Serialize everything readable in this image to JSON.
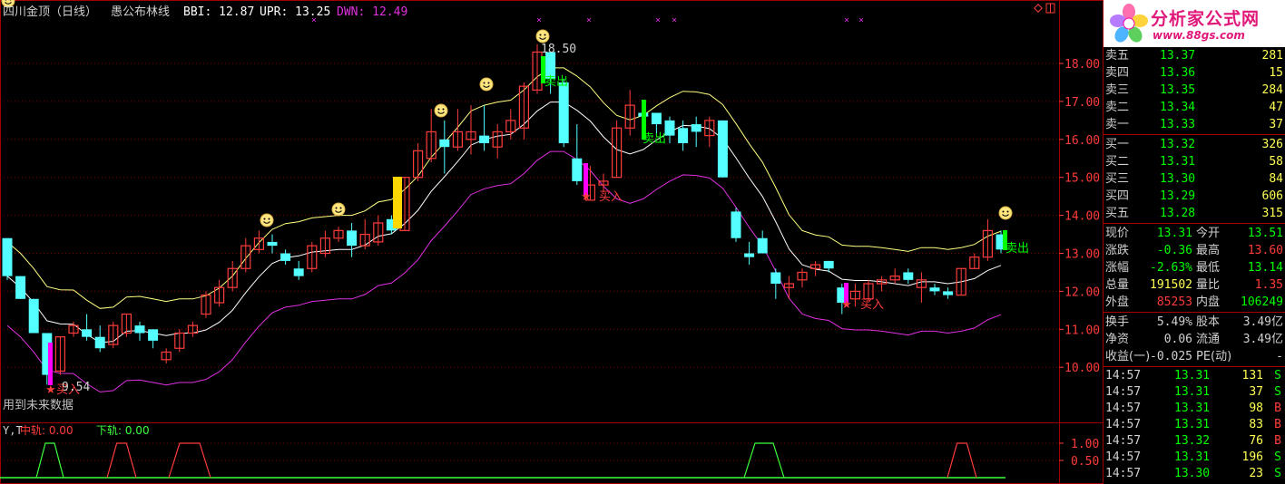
{
  "title": {
    "name": "四川金顶（日线）",
    "indicator": "愚公布林线",
    "bbi": "BBI: 12.87",
    "upr": "UPR: 13.25",
    "dwn": "DWN: 12.49"
  },
  "chart": {
    "high_price": "18.50",
    "low_price": "9.54",
    "warning": "用到未来数据",
    "signals": {
      "buy": "买入",
      "sell": "卖出"
    }
  },
  "price_axis": [
    "18.00",
    "17.00",
    "16.00",
    "15.00",
    "14.00",
    "13.00",
    "12.00",
    "11.00",
    "10.00"
  ],
  "sub_indicator": {
    "name": "Y,T",
    "mid": "中轨: 0.00",
    "low": "下轨: 0.00",
    "axis": [
      "1.00",
      "0.50"
    ]
  },
  "logo": {
    "title": "分析家公式网",
    "url": "www.88gs.com"
  },
  "order_book": {
    "asks": [
      {
        "label": "卖五",
        "price": "13.37",
        "volume": "281"
      },
      {
        "label": "卖四",
        "price": "13.36",
        "volume": "15"
      },
      {
        "label": "卖三",
        "price": "13.35",
        "volume": "284"
      },
      {
        "label": "卖二",
        "price": "13.34",
        "volume": "47"
      },
      {
        "label": "卖一",
        "price": "13.33",
        "volume": "37"
      }
    ],
    "bids": [
      {
        "label": "买一",
        "price": "13.32",
        "volume": "326"
      },
      {
        "label": "买二",
        "price": "13.31",
        "volume": "58"
      },
      {
        "label": "买三",
        "price": "13.30",
        "volume": "84"
      },
      {
        "label": "买四",
        "price": "13.29",
        "volume": "606"
      },
      {
        "label": "买五",
        "price": "13.28",
        "volume": "315"
      }
    ]
  },
  "quote": [
    {
      "l1": "现价",
      "v1": "13.31",
      "l2": "今开",
      "v2": "13.51"
    },
    {
      "l1": "涨跌",
      "v1": "-0.36",
      "l2": "最高",
      "v2": "13.60"
    },
    {
      "l1": "涨幅",
      "v1": "-2.63%",
      "l2": "最低",
      "v2": "13.14"
    },
    {
      "l1": "总量",
      "v1": "191502",
      "l2": "量比",
      "v2": "1.35"
    },
    {
      "l1": "外盘",
      "v1": "85253",
      "l2": "内盘",
      "v2": "106249"
    }
  ],
  "fundamentals": [
    {
      "l1": "换手",
      "v1": "5.49%",
      "l2": "股本",
      "v2": "3.49亿"
    },
    {
      "l1": "净资",
      "v1": "0.06",
      "l2": "流通",
      "v2": "3.49亿"
    },
    {
      "l1": "收益(一)",
      "v1": "-0.025",
      "l2": "PE(动)",
      "v2": "-"
    }
  ],
  "ticks": [
    {
      "time": "14:57",
      "price": "13.31",
      "volume": "131",
      "side": "S"
    },
    {
      "time": "14:57",
      "price": "13.31",
      "volume": "37",
      "side": "S"
    },
    {
      "time": "14:57",
      "price": "13.31",
      "volume": "98",
      "side": "B"
    },
    {
      "time": "14:57",
      "price": "13.31",
      "volume": "83",
      "side": "B"
    },
    {
      "time": "14:57",
      "price": "13.32",
      "volume": "76",
      "side": "B"
    },
    {
      "time": "14:57",
      "price": "13.31",
      "volume": "196",
      "side": "S"
    },
    {
      "time": "14:57",
      "price": "13.30",
      "volume": "23",
      "side": "S"
    }
  ],
  "colors": {
    "up": "#ff3c3c",
    "down": "#54ffff",
    "bbi": "#ffffff",
    "upr": "#ffff80",
    "dwn": "#e030e0",
    "grid": "#800000",
    "axis": "#ff3c3c",
    "buy": "#ff00ff",
    "sell": "#00ff00",
    "signal_fill": "#ffd700"
  },
  "chart_data": {
    "type": "candlestick",
    "series": [
      {
        "name": "BBI"
      },
      {
        "name": "UPR"
      },
      {
        "name": "DWN"
      }
    ],
    "y_range": [
      9.6,
      18.8
    ],
    "candles": [
      [
        13.4,
        12.4,
        13.4,
        12.3
      ],
      [
        12.4,
        11.8,
        12.4,
        11.8
      ],
      [
        11.8,
        10.9,
        11.8,
        10.9
      ],
      [
        10.9,
        9.8,
        10.9,
        9.54
      ],
      [
        9.9,
        10.8,
        10.8,
        9.8
      ],
      [
        10.9,
        11.1,
        11.2,
        10.8
      ],
      [
        11.0,
        10.8,
        11.4,
        10.7
      ],
      [
        10.8,
        10.5,
        11.1,
        10.4
      ],
      [
        10.6,
        11.1,
        11.2,
        10.5
      ],
      [
        10.9,
        11.4,
        11.4,
        10.8
      ],
      [
        11.1,
        10.9,
        11.2,
        10.7
      ],
      [
        11.0,
        10.7,
        11.0,
        10.5
      ],
      [
        10.2,
        10.4,
        10.5,
        10.1
      ],
      [
        10.5,
        10.9,
        11.0,
        10.4
      ],
      [
        10.9,
        11.1,
        11.2,
        10.8
      ],
      [
        11.4,
        11.9,
        12.0,
        11.3
      ],
      [
        11.7,
        12.1,
        12.3,
        11.6
      ],
      [
        12.1,
        12.6,
        12.8,
        12.0
      ],
      [
        12.6,
        13.2,
        13.4,
        12.5
      ],
      [
        13.1,
        13.4,
        13.6,
        13.0
      ],
      [
        13.3,
        13.2,
        13.5,
        13.0
      ],
      [
        13.0,
        12.8,
        13.1,
        12.7
      ],
      [
        12.6,
        12.4,
        12.8,
        12.3
      ],
      [
        12.6,
        13.2,
        13.3,
        12.5
      ],
      [
        13.0,
        13.4,
        13.6,
        12.9
      ],
      [
        13.4,
        13.6,
        13.7,
        13.3
      ],
      [
        13.6,
        13.2,
        13.8,
        12.9
      ],
      [
        13.2,
        13.5,
        13.9,
        13.1
      ],
      [
        13.3,
        13.8,
        14.0,
        13.2
      ],
      [
        13.9,
        13.6,
        14.0,
        13.5
      ],
      [
        13.6,
        15.0,
        15.0,
        13.6
      ],
      [
        15.0,
        15.7,
        15.9,
        14.9
      ],
      [
        15.5,
        16.2,
        16.8,
        15.4
      ],
      [
        16.0,
        15.8,
        16.5,
        15.1
      ],
      [
        15.8,
        16.2,
        16.8,
        15.7
      ],
      [
        16.0,
        16.2,
        16.9,
        15.6
      ],
      [
        16.1,
        15.9,
        16.9,
        15.7
      ],
      [
        15.8,
        16.2,
        16.4,
        15.5
      ],
      [
        16.2,
        16.5,
        16.8,
        16.0
      ],
      [
        16.3,
        17.4,
        17.5,
        16.0
      ],
      [
        17.3,
        18.3,
        18.5,
        17.2
      ],
      [
        18.3,
        17.6,
        18.3,
        17.2
      ],
      [
        17.5,
        15.9,
        17.6,
        15.8
      ],
      [
        15.5,
        14.9,
        16.4,
        14.8
      ],
      [
        14.4,
        14.8,
        15.3,
        14.4
      ],
      [
        14.8,
        14.9,
        15.1,
        14.6
      ],
      [
        15.0,
        16.3,
        16.5,
        15.0
      ],
      [
        16.3,
        16.9,
        17.3,
        16.1
      ],
      [
        16.7,
        16.6,
        16.9,
        16.3
      ],
      [
        16.7,
        16.4,
        16.7,
        16.1
      ],
      [
        16.5,
        16.1,
        16.6,
        15.9
      ],
      [
        16.3,
        15.9,
        16.5,
        15.7
      ],
      [
        16.4,
        16.2,
        16.6,
        15.8
      ],
      [
        16.1,
        16.5,
        16.6,
        15.8
      ],
      [
        16.5,
        15.0,
        16.5,
        15.0
      ],
      [
        14.1,
        13.4,
        14.2,
        13.3
      ],
      [
        13.0,
        12.9,
        13.3,
        12.7
      ],
      [
        13.4,
        13.0,
        13.6,
        13.0
      ],
      [
        12.5,
        12.2,
        12.6,
        11.8
      ],
      [
        12.1,
        12.2,
        12.4,
        11.8
      ],
      [
        12.3,
        12.5,
        12.6,
        12.1
      ],
      [
        12.6,
        12.7,
        12.8,
        12.4
      ],
      [
        12.8,
        12.6,
        12.8,
        12.5
      ],
      [
        12.1,
        11.7,
        12.2,
        11.4
      ],
      [
        11.8,
        12.0,
        12.2,
        11.6
      ],
      [
        11.8,
        12.2,
        12.3,
        11.7
      ],
      [
        12.2,
        12.3,
        12.4,
        12.0
      ],
      [
        12.3,
        12.4,
        12.6,
        12.2
      ],
      [
        12.5,
        12.3,
        12.6,
        12.2
      ],
      [
        12.1,
        12.3,
        12.5,
        11.7
      ],
      [
        12.1,
        12.0,
        12.2,
        11.9
      ],
      [
        12.0,
        11.9,
        12.1,
        11.8
      ],
      [
        11.9,
        12.6,
        12.6,
        11.9
      ],
      [
        12.6,
        12.9,
        13.0,
        12.6
      ],
      [
        12.9,
        13.6,
        13.9,
        12.8
      ],
      [
        13.5,
        13.1,
        13.6,
        13.0
      ]
    ]
  }
}
